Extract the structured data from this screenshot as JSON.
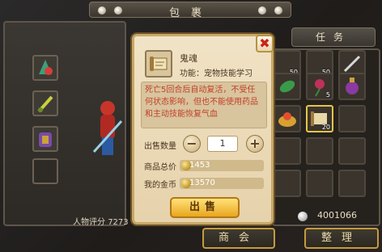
{
  "header": {
    "title": "包裹"
  },
  "tabs": {
    "right_tab_label": "任务"
  },
  "left_panel": {
    "score_label": "人物评分",
    "score_value": "7273"
  },
  "inventory": {
    "counts": [
      "50",
      "50",
      "5",
      "20"
    ],
    "silver_amount": "4001066"
  },
  "footer": {
    "guild_label": "商会",
    "sort_label": "整理"
  },
  "dialog": {
    "item_name": "鬼魂",
    "item_function": "功能：宠物技能学习",
    "description": "死亡5回合后自动复活，不受任何状态影响，但也不能使用药品和主动技能恢复气血",
    "quantity_label": "出售数量",
    "quantity_value": "1",
    "total_price_label": "商品总价",
    "total_price_value": "1453",
    "my_gold_label": "我的金币",
    "my_gold_value": "13570",
    "sell_label": "出售",
    "close_glyph": "✖",
    "minus_glyph": "−",
    "plus_glyph": "+"
  },
  "colors": {
    "accent_gold": "#e8a61e",
    "desc_red": "#c23f2a",
    "close_red": "#c8231a"
  }
}
